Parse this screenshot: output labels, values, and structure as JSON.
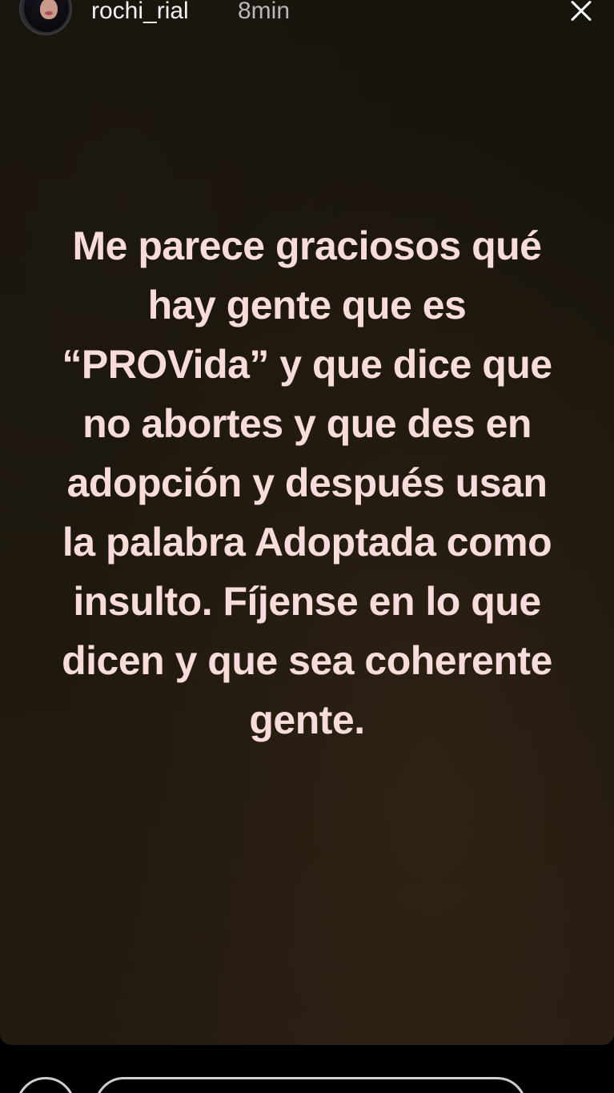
{
  "header": {
    "username": "rochi_rial",
    "timestamp": "8min",
    "avatar_icon": "profile-photo-icon",
    "close_icon": "close-icon"
  },
  "story": {
    "lines": [
      "Me parece graciosos qué",
      "hay gente que es",
      "“PROVida” y que dice que",
      "no abortes y que des en",
      "adopción y después usan",
      "la palabra Adoptada como",
      "insulto.  Fíjense en lo que",
      "dicen y que sea coherente",
      "gente."
    ],
    "text_color": "#f8dcdc",
    "background_color": "#1b160e"
  },
  "footer": {
    "camera_icon": "camera-icon"
  }
}
